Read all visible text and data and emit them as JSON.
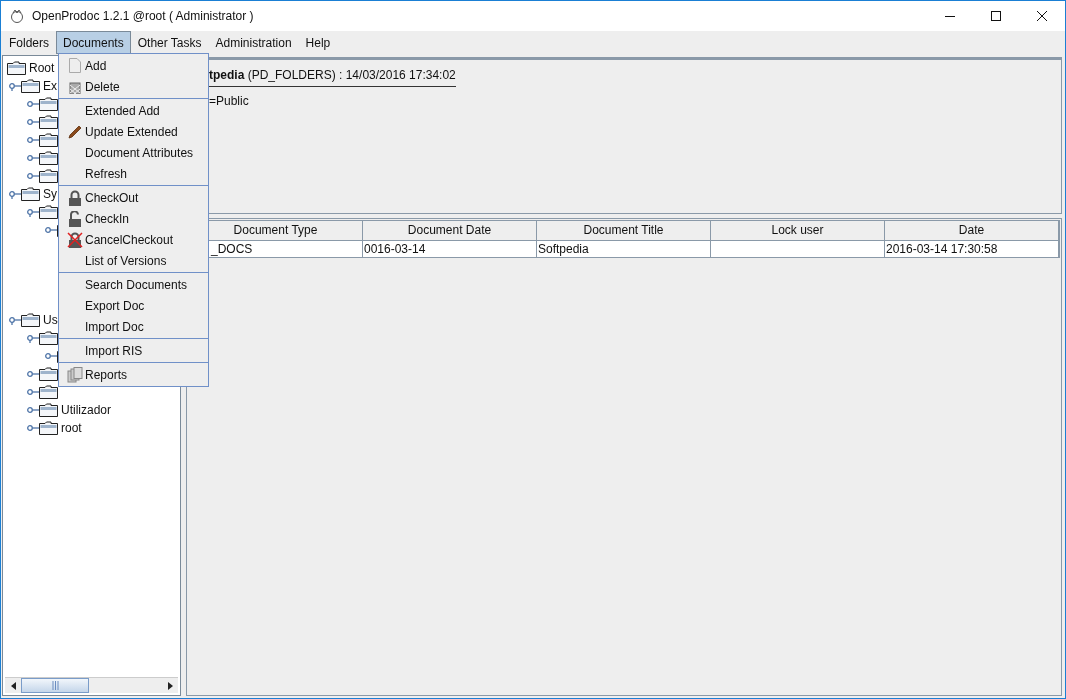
{
  "window": {
    "title": "OpenProdoc 1.2.1 @root ( Administrator )"
  },
  "menu_bar": [
    {
      "label": "Folders",
      "selected": false
    },
    {
      "label": "Documents",
      "selected": true
    },
    {
      "label": "Other Tasks",
      "selected": false
    },
    {
      "label": "Administration",
      "selected": false
    },
    {
      "label": "Help",
      "selected": false
    }
  ],
  "open_menu": {
    "groups": [
      [
        {
          "label": "Add"
        },
        {
          "label": "Delete"
        }
      ],
      [
        {
          "label": "Extended Add"
        },
        {
          "label": "Update Extended"
        },
        {
          "label": "Document Attributes"
        },
        {
          "label": "Refresh"
        }
      ],
      [
        {
          "label": "CheckOut"
        },
        {
          "label": "CheckIn"
        },
        {
          "label": "CancelCheckout"
        },
        {
          "label": "List of Versions"
        }
      ],
      [
        {
          "label": "Search Documents"
        },
        {
          "label": "Export Doc"
        },
        {
          "label": "Import Doc"
        }
      ],
      [
        {
          "label": "Import RIS"
        }
      ],
      [
        {
          "label": "Reports"
        }
      ]
    ]
  },
  "tree": {
    "label": "Root",
    "children": [
      {
        "label": "Ex",
        "expanded": true,
        "children": [
          {
            "expanded": false
          },
          {
            "expanded": false
          },
          {
            "expanded": false
          },
          {
            "expanded": false
          },
          {
            "expanded": false
          }
        ]
      },
      {
        "label": "Sy",
        "expanded": true,
        "children": [
          {
            "expanded": true,
            "children": [
              {
                "expanded": false
              }
            ]
          }
        ]
      },
      {
        "label": "Us",
        "expanded": true,
        "children": [
          {
            "expanded": true,
            "children": [
              {
                "expanded": false
              }
            ]
          },
          {
            "expanded": false
          },
          {
            "expanded": false
          },
          {
            "label": "Utilizador",
            "expanded": false
          },
          {
            "label": "root",
            "expanded": false
          }
        ]
      }
    ]
  },
  "folder_info": {
    "heading": "**tpedia** (PD_FOLDERS) : 14/03/2016 17:34:02",
    "detail": "=Public"
  },
  "table": {
    "columns": [
      "Document Type",
      "Document Date",
      "Document Title",
      "Lock user",
      "Date"
    ],
    "rows": [
      [
        "_DOCS",
        "0016-03-14",
        "Softpedia",
        "",
        "2016-03-14 17:30:58"
      ]
    ]
  }
}
